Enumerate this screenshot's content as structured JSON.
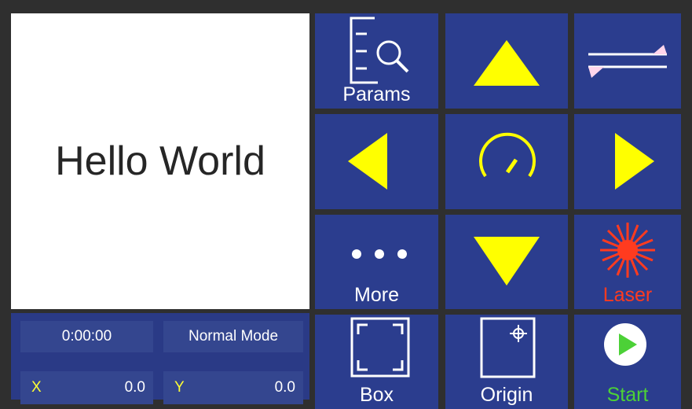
{
  "preview": {
    "text": "Hello World"
  },
  "status": {
    "time": "0:00:00",
    "mode": "Normal Mode",
    "x_label": "X",
    "x_value": "0.0",
    "y_label": "Y",
    "y_value": "0.0"
  },
  "buttons": {
    "params": "Params",
    "more": "More",
    "laser": "Laser",
    "box": "Box",
    "origin": "Origin",
    "start": "Start"
  },
  "colors": {
    "button_bg": "#2b3d8e",
    "arrow": "#ffff00",
    "laser": "#ff3b1f",
    "start": "#4cd137",
    "panel_bg": "#2a3a86"
  }
}
